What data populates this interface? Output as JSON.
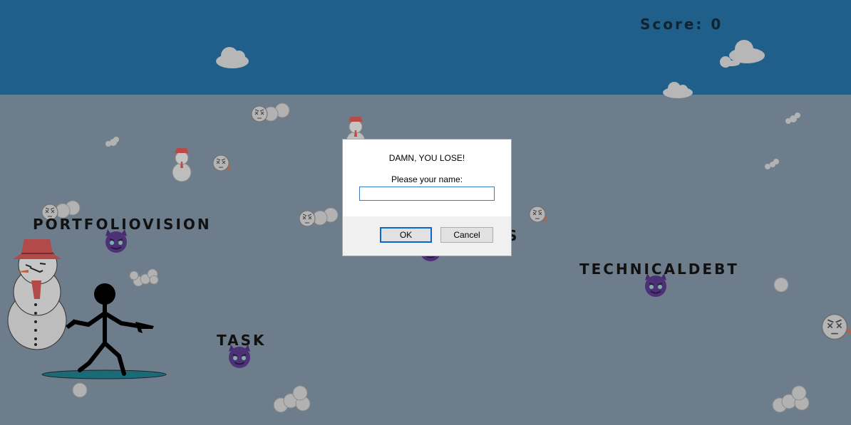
{
  "game": {
    "score_text": "Score: 0",
    "colors": {
      "sky": "#1f5f89",
      "ground": "#6e7d8b"
    },
    "enemies": [
      {
        "label": "PORTFOLIOVISION",
        "icon": "devil-emoji-icon"
      },
      {
        "label": "TASK",
        "icon": "devil-emoji-icon"
      },
      {
        "label": "TECHNICALDEBT",
        "icon": "devil-emoji-icon"
      },
      {
        "label": "S",
        "icon": "devil-emoji-icon"
      }
    ]
  },
  "dialog": {
    "title": "DAMN, YOU LOSE!",
    "prompt": "Please your name:",
    "input_value": "",
    "ok_label": "OK",
    "cancel_label": "Cancel"
  }
}
